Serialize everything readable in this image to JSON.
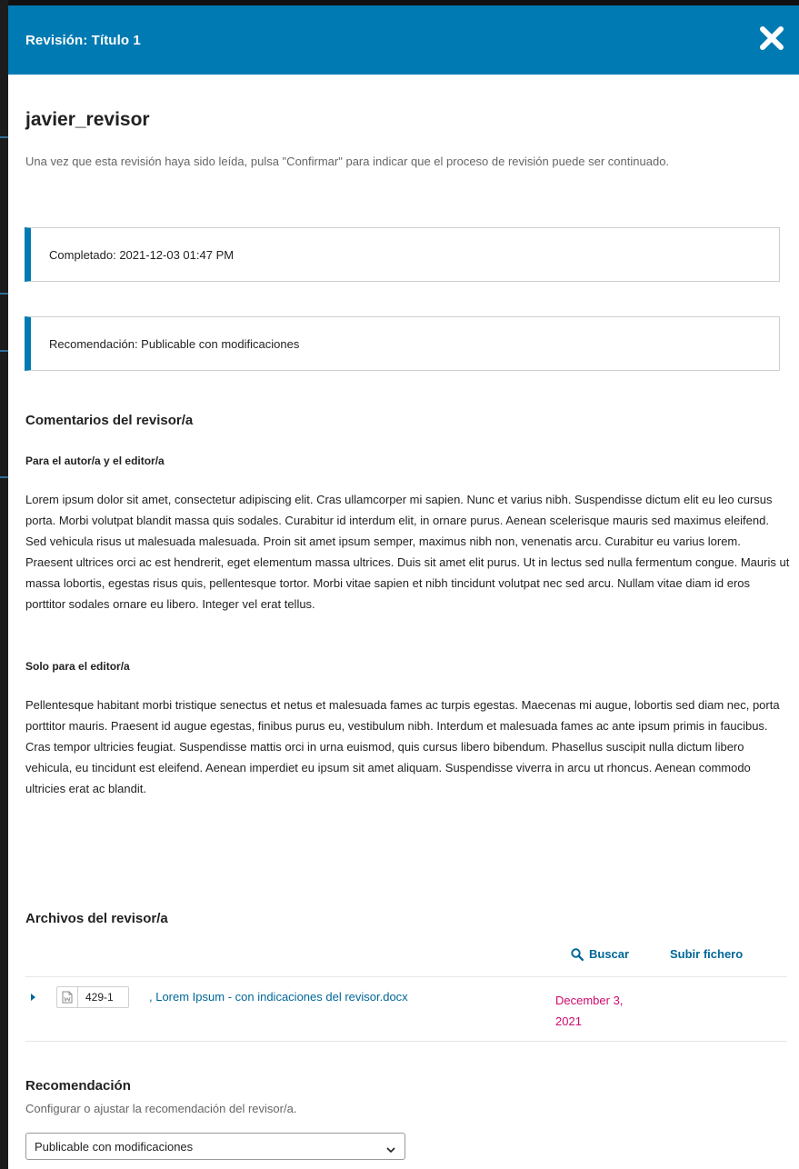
{
  "modal": {
    "title": "Revisión: Título 1"
  },
  "reviewer": {
    "name": "javier_revisor"
  },
  "intro_text": "Una vez que esta revisión haya sido leída, pulsa \"Confirmar\" para indicar que el proceso de revisión puede ser continuado.",
  "notices": {
    "completed": "Completado: 2021-12-03 01:47 PM",
    "recommendation": "Recomendación: Publicable con modificaciones"
  },
  "comments": {
    "heading": "Comentarios del revisor/a",
    "author_editor": {
      "heading": "Para el autor/a y el editor/a",
      "text": "Lorem ipsum dolor sit amet, consectetur adipiscing elit. Cras ullamcorper mi sapien. Nunc et varius nibh. Suspendisse dictum elit eu leo cursus porta. Morbi volutpat blandit massa quis sodales. Curabitur id interdum elit, in ornare purus. Aenean scelerisque mauris sed maximus eleifend. Sed vehicula risus ut malesuada malesuada. Proin sit amet ipsum semper, maximus nibh non, venenatis arcu. Curabitur eu varius lorem. Praesent ultrices orci ac est hendrerit, eget elementum massa ultrices. Duis sit amet elit purus. Ut in lectus sed nulla fermentum congue. Mauris ut massa lobortis, egestas risus quis, pellentesque tortor. Morbi vitae sapien et nibh tincidunt volutpat nec sed arcu. Nullam vitae diam id eros porttitor sodales ornare eu libero. Integer vel erat tellus."
    },
    "editor_only": {
      "heading": "Solo para el editor/a",
      "text": "Pellentesque habitant morbi tristique senectus et netus et malesuada fames ac turpis egestas. Maecenas mi augue, lobortis sed diam nec, porta porttitor mauris. Praesent id augue egestas, finibus purus eu, vestibulum nibh. Interdum et malesuada fames ac ante ipsum primis in faucibus. Cras tempor ultricies feugiat. Suspendisse mattis orci in urna euismod, quis cursus libero bibendum. Phasellus suscipit nulla dictum libero vehicula, eu tincidunt est eleifend. Aenean imperdiet eu ipsum sit amet aliquam. Suspendisse viverra in arcu ut rhoncus. Aenean commodo ultricies erat ac blandit."
    }
  },
  "files": {
    "heading": "Archivos del revisor/a",
    "search_label": "Buscar",
    "upload_label": "Subir fichero",
    "items": [
      {
        "id": "429-1",
        "name": ", Lorem Ipsum - con indicaciones del revisor.docx",
        "date": "December 3, 2021",
        "icon": "word-doc-icon"
      }
    ]
  },
  "recommendation": {
    "heading": "Recomendación",
    "help": "Configurar o ajustar la recomendación del revisor/a.",
    "selected": "Publicable con modificaciones"
  },
  "colors": {
    "header": "#007ab2",
    "link": "#006798",
    "date": "#d00a6c"
  }
}
